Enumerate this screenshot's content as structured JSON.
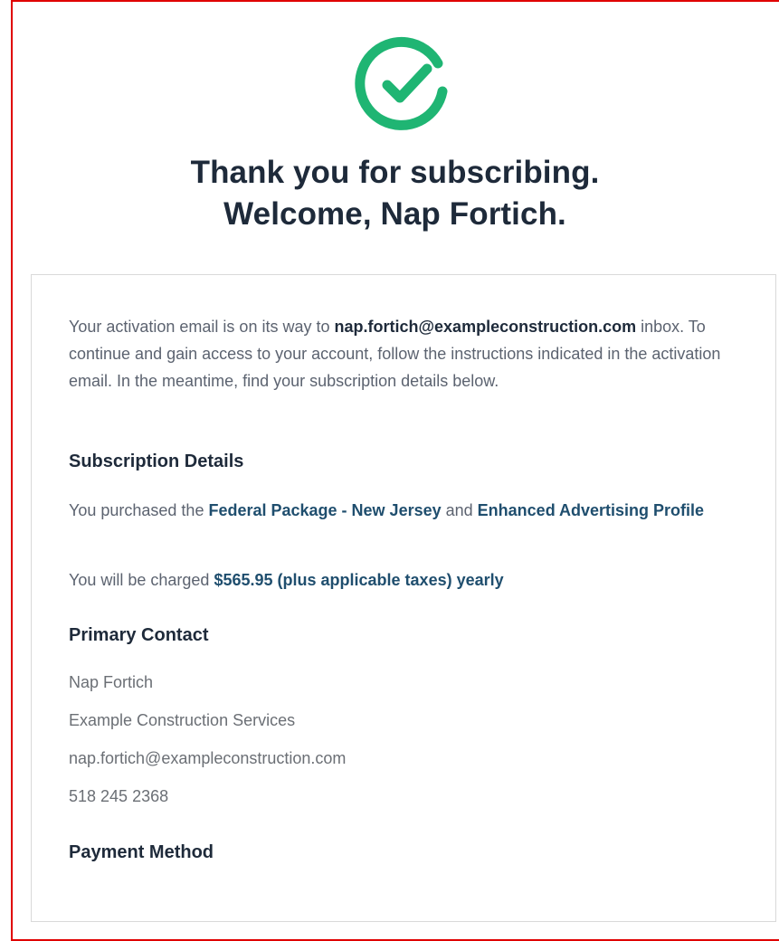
{
  "header": {
    "title_line1": "Thank you for subscribing.",
    "title_line2": "Welcome, Nap Fortich.",
    "icon": "check-circle-icon",
    "icon_color": "#1fb573"
  },
  "intro": {
    "text_before": "Your activation email is on its way to ",
    "email": "nap.fortich@exampleconstruction.com",
    "text_after": " inbox. To continue and gain access to your account, follow the instructions indicated in the activation email. In the meantime, find your subscription details below."
  },
  "subscription": {
    "heading": "Subscription Details",
    "purchase_prefix": "You purchased the ",
    "package": "Federal Package - New Jersey",
    "and": " and ",
    "addon": "Enhanced Advertising Profile",
    "charge_prefix": "You will be charged ",
    "charge": "$565.95 (plus applicable taxes) yearly"
  },
  "contact": {
    "heading": "Primary Contact",
    "name": "Nap Fortich",
    "company": "Example Construction Services",
    "email": "nap.fortich@exampleconstruction.com",
    "phone": "518 245 2368"
  },
  "payment": {
    "heading": "Payment Method"
  },
  "colors": {
    "frame_border": "#e00000",
    "accent_text": "#1f4e6e",
    "heading_text": "#1e2a3a",
    "success_green": "#1fb573"
  }
}
